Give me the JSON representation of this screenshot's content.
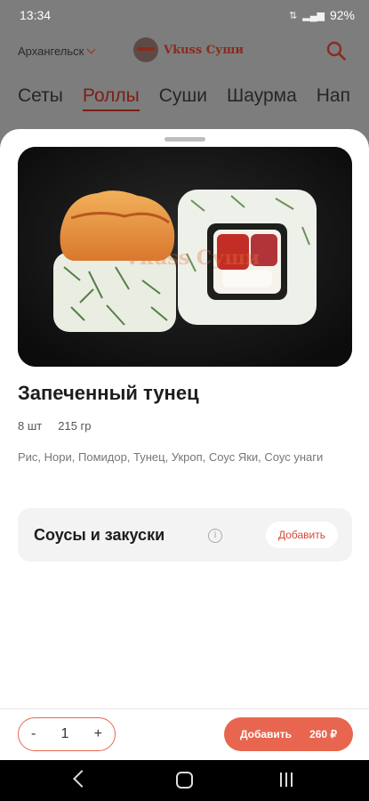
{
  "status": {
    "time": "13:34",
    "battery": "92%"
  },
  "header": {
    "city": "Архангельск",
    "logo_text": "Vkuss Суши"
  },
  "tabs": [
    {
      "label": "Сеты",
      "active": false
    },
    {
      "label": "Роллы",
      "active": true
    },
    {
      "label": "Суши",
      "active": false
    },
    {
      "label": "Шаурма",
      "active": false
    },
    {
      "label": "Нап",
      "active": false
    }
  ],
  "product": {
    "watermark": "Vkuss Суши",
    "title": "Запеченный тунец",
    "quantity_text": "8 шт",
    "weight_text": "215 гр",
    "description": "Рис, Нори, Помидор, Тунец, Укроп, Соус Яки, Соус унаги"
  },
  "extras": {
    "label": "Соусы и закуски",
    "info_icon": "i",
    "add_label": "Добавить"
  },
  "order": {
    "minus": "-",
    "quantity": "1",
    "plus": "+",
    "add_label": "Добавить",
    "price": "260 ₽"
  },
  "colors": {
    "accent": "#e8664f",
    "dark_accent": "#7a2016"
  }
}
